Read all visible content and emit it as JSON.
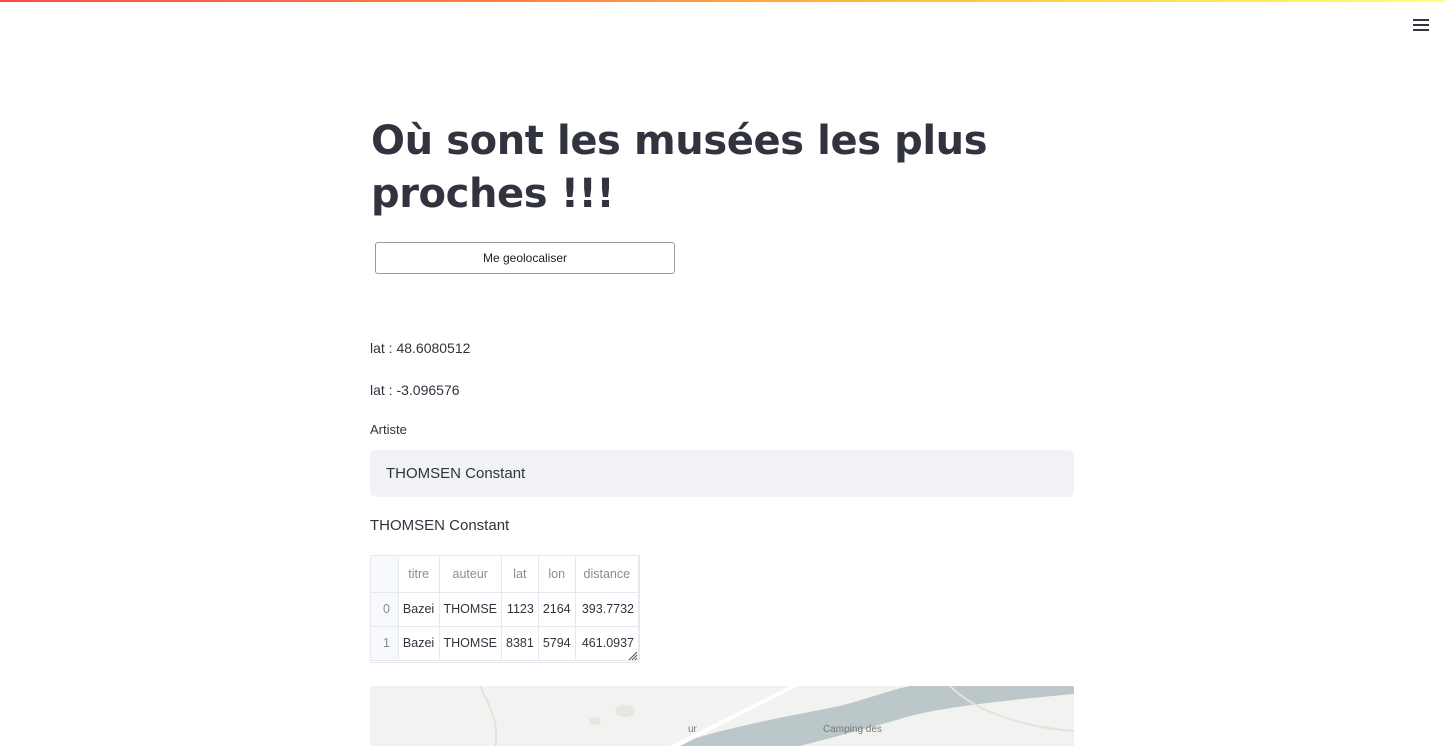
{
  "app": {
    "title": "Où sont les musées les plus proches !!!",
    "menu_icon": "hamburger-menu-icon",
    "accent_gradient": [
      "#ff4b4b",
      "#ff8a3d",
      "#ffd84d",
      "#fffd80"
    ]
  },
  "geolocate": {
    "button_label": "Me geolocaliser"
  },
  "coords": {
    "lat_text": "lat : 48.6080512",
    "lon_text": "lat : -3.096576"
  },
  "artist": {
    "label": "Artiste",
    "value": "THOMSEN Constant",
    "echo": "THOMSEN Constant"
  },
  "table": {
    "columns": [
      "titre",
      "auteur",
      "lat",
      "lon",
      "distance"
    ],
    "rows": [
      {
        "index": "0",
        "titre": "Bazei",
        "auteur": "THOMSE",
        "lat": "1123",
        "lon": "2164",
        "distance": "393.7732"
      },
      {
        "index": "1",
        "titre": "Bazei",
        "auteur": "THOMSE",
        "lat": "8381",
        "lon": "5794",
        "distance": "461.0937"
      }
    ]
  },
  "map": {
    "visible_labels": [
      "Camping des",
      "ur"
    ],
    "water_color": "#bcc7c9",
    "land_color": "#f2f2f0"
  }
}
